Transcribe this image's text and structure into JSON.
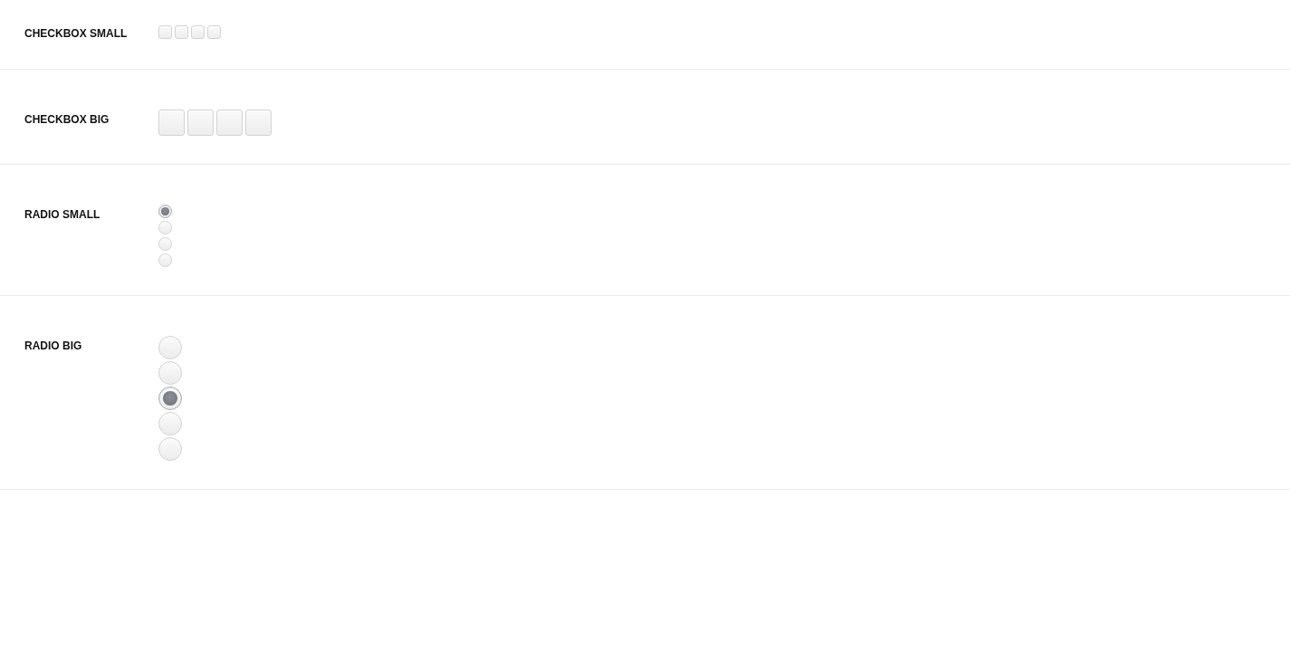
{
  "sections": [
    {
      "label": "CHECKBOX SMALL",
      "kind": "checkbox",
      "large": false,
      "items": [
        {
          "checked": false
        },
        {
          "checked": false
        },
        {
          "checked": false
        },
        {
          "checked": false
        }
      ]
    },
    {
      "label": "CHECKBOX BIG",
      "kind": "checkbox",
      "large": true,
      "items": [
        {
          "checked": false
        },
        {
          "checked": false
        },
        {
          "checked": false
        },
        {
          "checked": false
        }
      ]
    },
    {
      "label": "RADIO SMALL",
      "kind": "radio",
      "large": false,
      "items": [
        {
          "selected": true
        },
        {
          "selected": false
        },
        {
          "selected": false
        },
        {
          "selected": false
        }
      ]
    },
    {
      "label": "RADIO BIG",
      "kind": "radio",
      "large": true,
      "items": [
        {
          "selected": false
        },
        {
          "selected": false
        },
        {
          "selected": true
        },
        {
          "selected": false
        },
        {
          "selected": false
        }
      ]
    }
  ]
}
